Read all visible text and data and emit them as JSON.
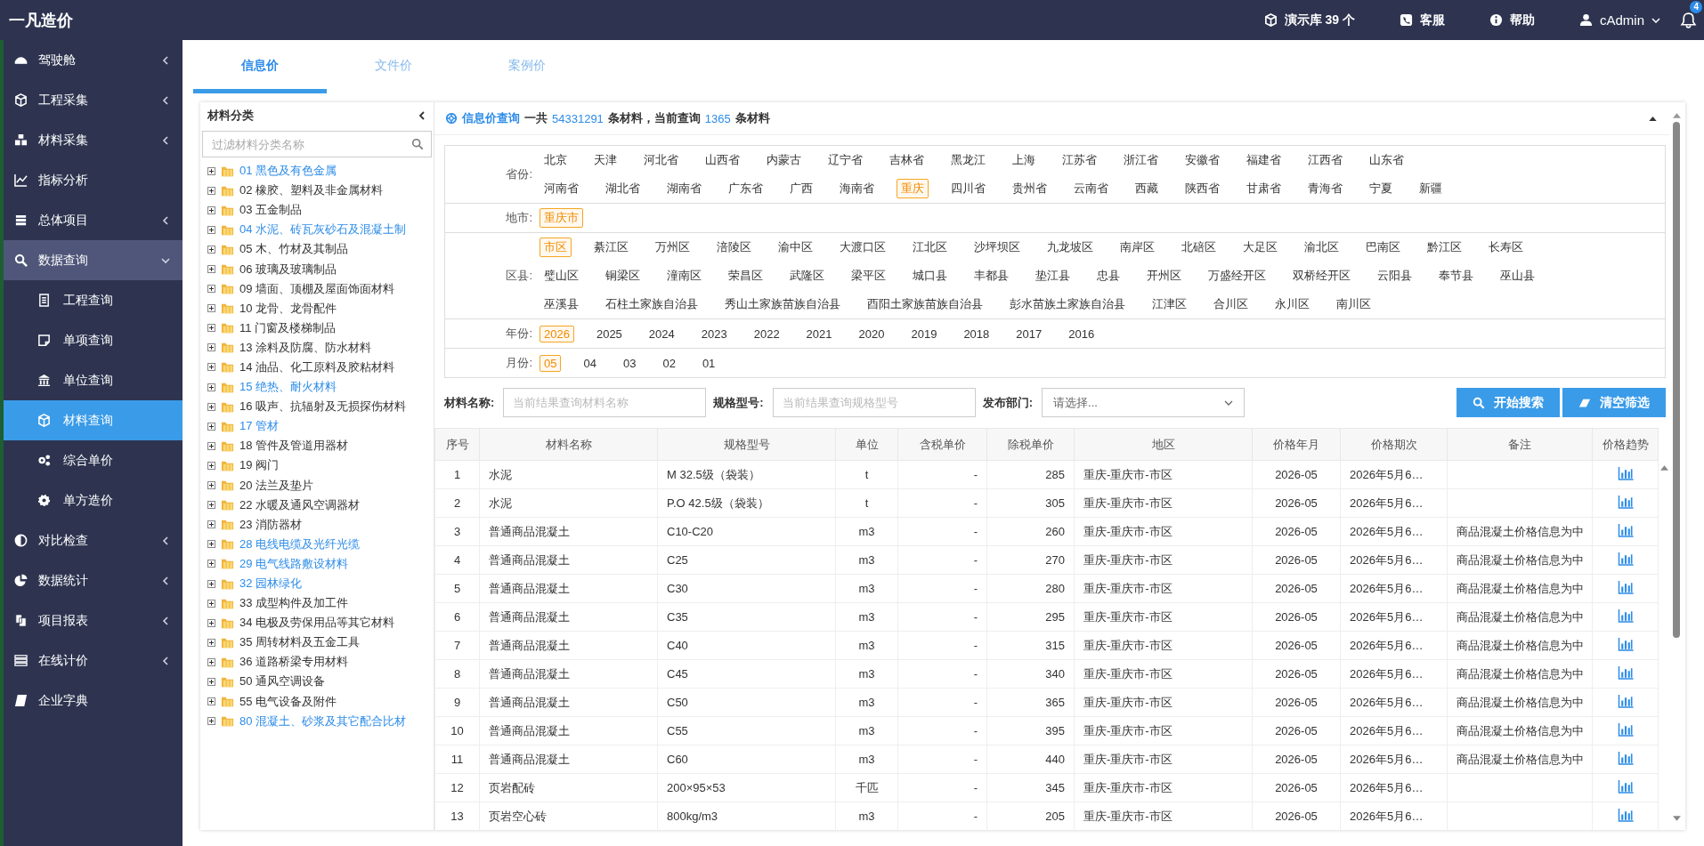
{
  "header": {
    "logo": "一凡造价",
    "library": "演示库 39 个",
    "service": "客服",
    "help": "帮助",
    "user": "cAdmin",
    "notifications": "4"
  },
  "sidebar": {
    "items": [
      {
        "label": "驾驶舱",
        "kind": "group",
        "expanded": false,
        "selected": false
      },
      {
        "label": "工程采集",
        "kind": "group",
        "expanded": false,
        "selected": false
      },
      {
        "label": "材料采集",
        "kind": "group",
        "expanded": false,
        "selected": false
      },
      {
        "label": "指标分析",
        "kind": "link",
        "selected": false
      },
      {
        "label": "总体项目",
        "kind": "group",
        "expanded": false,
        "selected": false
      },
      {
        "label": "数据查询",
        "kind": "group",
        "expanded": true,
        "selected": false,
        "children": [
          {
            "label": "工程查询",
            "selected": false
          },
          {
            "label": "单项查询",
            "selected": false
          },
          {
            "label": "单位查询",
            "selected": false
          },
          {
            "label": "材料查询",
            "selected": true
          },
          {
            "label": "综合单价",
            "selected": false
          },
          {
            "label": "单方造价",
            "selected": false
          }
        ]
      },
      {
        "label": "对比检查",
        "kind": "group",
        "expanded": false,
        "selected": false
      },
      {
        "label": "数据统计",
        "kind": "group",
        "expanded": false,
        "selected": false
      },
      {
        "label": "项目报表",
        "kind": "group",
        "expanded": false,
        "selected": false
      },
      {
        "label": "在线计价",
        "kind": "group",
        "expanded": false,
        "selected": false
      },
      {
        "label": "企业字典",
        "kind": "link",
        "selected": false
      }
    ]
  },
  "tabs": [
    {
      "label": "信息价",
      "selected": true
    },
    {
      "label": "文件价",
      "selected": false
    },
    {
      "label": "案例价",
      "selected": false
    }
  ],
  "category_tree": {
    "title": "材料分类",
    "search": {
      "placeholder": "过滤材料分类名称"
    },
    "items": [
      {
        "label": "01 黑色及有色金属",
        "highlighted": true,
        "expanded": false
      },
      {
        "label": "02 橡胶、塑料及非金属材料",
        "highlighted": false,
        "expanded": false
      },
      {
        "label": "03 五金制品",
        "highlighted": false,
        "expanded": false
      },
      {
        "label": "04 水泥、砖瓦灰砂石及混凝土制",
        "highlighted": true,
        "expanded": false
      },
      {
        "label": "05 木、竹材及其制品",
        "highlighted": false,
        "expanded": false
      },
      {
        "label": "06 玻璃及玻璃制品",
        "highlighted": false,
        "expanded": false
      },
      {
        "label": "09 墙面、顶棚及屋面饰面材料",
        "highlighted": false,
        "expanded": false
      },
      {
        "label": "10 龙骨、龙骨配件",
        "highlighted": false,
        "expanded": false
      },
      {
        "label": "11 门窗及楼梯制品",
        "highlighted": false,
        "expanded": false
      },
      {
        "label": "13 涂料及防腐、防水材料",
        "highlighted": false,
        "expanded": false
      },
      {
        "label": "14 油品、化工原料及胶粘材料",
        "highlighted": false,
        "expanded": false
      },
      {
        "label": "15 绝热、耐火材料",
        "highlighted": true,
        "expanded": false
      },
      {
        "label": "16 吸声、抗辐射及无损探伤材料",
        "highlighted": false,
        "expanded": false
      },
      {
        "label": "17 管材",
        "highlighted": true,
        "expanded": false
      },
      {
        "label": "18 管件及管道用器材",
        "highlighted": false,
        "expanded": false
      },
      {
        "label": "19 阀门",
        "highlighted": false,
        "expanded": false
      },
      {
        "label": "20 法兰及垫片",
        "highlighted": false,
        "expanded": false
      },
      {
        "label": "22 水暖及通风空调器材",
        "highlighted": false,
        "expanded": false
      },
      {
        "label": "23 消防器材",
        "highlighted": false,
        "expanded": false
      },
      {
        "label": "28 电线电缆及光纤光缆",
        "highlighted": true,
        "expanded": false
      },
      {
        "label": "29 电气线路敷设材料",
        "highlighted": true,
        "expanded": false
      },
      {
        "label": "32 园林绿化",
        "highlighted": true,
        "expanded": false
      },
      {
        "label": "33 成型构件及加工件",
        "highlighted": false,
        "expanded": false
      },
      {
        "label": "34 电极及劳保用品等其它材料",
        "highlighted": false,
        "expanded": false
      },
      {
        "label": "35 周转材料及五金工具",
        "highlighted": false,
        "expanded": false
      },
      {
        "label": "36 道路桥梁专用材料",
        "highlighted": false,
        "expanded": false
      },
      {
        "label": "50 通风空调设备",
        "highlighted": false,
        "expanded": false
      },
      {
        "label": "55 电气设备及附件",
        "highlighted": false,
        "expanded": false
      },
      {
        "label": "80 混凝土、砂浆及其它配合比材",
        "highlighted": true,
        "expanded": false
      }
    ]
  },
  "query_panel": {
    "title": "信息价查询",
    "summary": [
      {
        "text": "一共",
        "accent": false
      },
      {
        "text": "54331291",
        "accent": true
      },
      {
        "text": "条材料，当前查询",
        "accent": false
      },
      {
        "text": "1365",
        "accent": true
      },
      {
        "text": "条材料",
        "accent": false
      }
    ]
  },
  "filters": [
    {
      "label": "省份:",
      "lines": [
        [
          {
            "label": "北京",
            "selected": false
          },
          {
            "label": "天津",
            "selected": false
          },
          {
            "label": "河北省",
            "selected": false
          },
          {
            "label": "山西省",
            "selected": false
          },
          {
            "label": "内蒙古",
            "selected": false
          },
          {
            "label": "辽宁省",
            "selected": false
          },
          {
            "label": "吉林省",
            "selected": false
          },
          {
            "label": "黑龙江",
            "selected": false
          },
          {
            "label": "上海",
            "selected": false
          },
          {
            "label": "江苏省",
            "selected": false
          },
          {
            "label": "浙江省",
            "selected": false
          },
          {
            "label": "安徽省",
            "selected": false
          },
          {
            "label": "福建省",
            "selected": false
          },
          {
            "label": "江西省",
            "selected": false
          },
          {
            "label": "山东省",
            "selected": false
          }
        ],
        [
          {
            "label": "河南省",
            "selected": false
          },
          {
            "label": "湖北省",
            "selected": false
          },
          {
            "label": "湖南省",
            "selected": false
          },
          {
            "label": "广东省",
            "selected": false
          },
          {
            "label": "广西",
            "selected": false
          },
          {
            "label": "海南省",
            "selected": false
          },
          {
            "label": "重庆",
            "selected": true
          },
          {
            "label": "四川省",
            "selected": false
          },
          {
            "label": "贵州省",
            "selected": false
          },
          {
            "label": "云南省",
            "selected": false
          },
          {
            "label": "西藏",
            "selected": false
          },
          {
            "label": "陕西省",
            "selected": false
          },
          {
            "label": "甘肃省",
            "selected": false
          },
          {
            "label": "青海省",
            "selected": false
          },
          {
            "label": "宁夏",
            "selected": false
          },
          {
            "label": "新疆",
            "selected": false
          }
        ]
      ]
    },
    {
      "label": "地市:",
      "lines": [
        [
          {
            "label": "重庆市",
            "selected": true
          }
        ]
      ]
    },
    {
      "label": "区县:",
      "lines": [
        [
          {
            "label": "市区",
            "selected": true
          },
          {
            "label": "綦江区",
            "selected": false
          },
          {
            "label": "万州区",
            "selected": false
          },
          {
            "label": "涪陵区",
            "selected": false
          },
          {
            "label": "渝中区",
            "selected": false
          },
          {
            "label": "大渡口区",
            "selected": false
          },
          {
            "label": "江北区",
            "selected": false
          },
          {
            "label": "沙坪坝区",
            "selected": false
          },
          {
            "label": "九龙坡区",
            "selected": false
          },
          {
            "label": "南岸区",
            "selected": false
          },
          {
            "label": "北碚区",
            "selected": false
          },
          {
            "label": "大足区",
            "selected": false
          },
          {
            "label": "渝北区",
            "selected": false
          },
          {
            "label": "巴南区",
            "selected": false
          },
          {
            "label": "黔江区",
            "selected": false
          },
          {
            "label": "长寿区",
            "selected": false
          }
        ],
        [
          {
            "label": "璧山区",
            "selected": false
          },
          {
            "label": "铜梁区",
            "selected": false
          },
          {
            "label": "潼南区",
            "selected": false
          },
          {
            "label": "荣昌区",
            "selected": false
          },
          {
            "label": "武隆区",
            "selected": false
          },
          {
            "label": "梁平区",
            "selected": false
          },
          {
            "label": "城口县",
            "selected": false
          },
          {
            "label": "丰都县",
            "selected": false
          },
          {
            "label": "垫江县",
            "selected": false
          },
          {
            "label": "忠县",
            "selected": false
          },
          {
            "label": "开州区",
            "selected": false
          },
          {
            "label": "万盛经开区",
            "selected": false
          },
          {
            "label": "双桥经开区",
            "selected": false
          },
          {
            "label": "云阳县",
            "selected": false
          },
          {
            "label": "奉节县",
            "selected": false
          },
          {
            "label": "巫山县",
            "selected": false
          }
        ],
        [
          {
            "label": "巫溪县",
            "selected": false
          },
          {
            "label": "石柱土家族自治县",
            "selected": false
          },
          {
            "label": "秀山土家族苗族自治县",
            "selected": false
          },
          {
            "label": "酉阳土家族苗族自治县",
            "selected": false
          },
          {
            "label": "彭水苗族土家族自治县",
            "selected": false
          },
          {
            "label": "江津区",
            "selected": false
          },
          {
            "label": "合川区",
            "selected": false
          },
          {
            "label": "永川区",
            "selected": false
          },
          {
            "label": "南川区",
            "selected": false
          }
        ]
      ]
    },
    {
      "label": "年份:",
      "lines": [
        [
          {
            "label": "2026",
            "selected": true
          },
          {
            "label": "2025",
            "selected": false
          },
          {
            "label": "2024",
            "selected": false
          },
          {
            "label": "2023",
            "selected": false
          },
          {
            "label": "2022",
            "selected": false
          },
          {
            "label": "2021",
            "selected": false
          },
          {
            "label": "2020",
            "selected": false
          },
          {
            "label": "2019",
            "selected": false
          },
          {
            "label": "2018",
            "selected": false
          },
          {
            "label": "2017",
            "selected": false
          },
          {
            "label": "2016",
            "selected": false
          }
        ]
      ]
    },
    {
      "label": "月份:",
      "lines": [
        [
          {
            "label": "05",
            "selected": true
          },
          {
            "label": "04",
            "selected": false
          },
          {
            "label": "03",
            "selected": false
          },
          {
            "label": "02",
            "selected": false
          },
          {
            "label": "01",
            "selected": false
          }
        ]
      ]
    }
  ],
  "search_form": {
    "fields": [
      {
        "label": "材料名称:",
        "kind": "input",
        "placeholder": "当前结果查询材料名称"
      },
      {
        "label": "规格型号:",
        "kind": "input",
        "placeholder": "当前结果查询规格型号"
      },
      {
        "label": "发布部门:",
        "kind": "select",
        "placeholder": "请选择..."
      }
    ],
    "buttons": [
      {
        "label": "开始搜索",
        "kind": "search"
      },
      {
        "label": "清空筛选",
        "kind": "clear"
      }
    ]
  },
  "table": {
    "columns": [
      "序号",
      "材料名称",
      "规格型号",
      "单位",
      "含税单价",
      "除税单价",
      "地区",
      "价格年月",
      "价格期次",
      "备注",
      "价格趋势"
    ],
    "rows": [
      {
        "no": "1",
        "name": "水泥",
        "spec": "M 32.5级（袋装）",
        "unit": "t",
        "tax_price": "-",
        "net_price": "285",
        "region": "重庆-重庆市-市区",
        "month": "2026-05",
        "period": "2026年5月6…"
      },
      {
        "no": "2",
        "name": "水泥",
        "spec": "P.O 42.5级（袋装）",
        "unit": "t",
        "tax_price": "-",
        "net_price": "305",
        "region": "重庆-重庆市-市区",
        "month": "2026-05",
        "period": "2026年5月6…"
      },
      {
        "no": "3",
        "name": "普通商品混凝土",
        "spec": "C10-C20",
        "unit": "m3",
        "tax_price": "-",
        "net_price": "260",
        "region": "重庆-重庆市-市区",
        "month": "2026-05",
        "period": "2026年5月6…",
        "note": "商品混凝土价格信息为中"
      },
      {
        "no": "4",
        "name": "普通商品混凝土",
        "spec": "C25",
        "unit": "m3",
        "tax_price": "-",
        "net_price": "270",
        "region": "重庆-重庆市-市区",
        "month": "2026-05",
        "period": "2026年5月6…",
        "note": "商品混凝土价格信息为中"
      },
      {
        "no": "5",
        "name": "普通商品混凝土",
        "spec": "C30",
        "unit": "m3",
        "tax_price": "-",
        "net_price": "280",
        "region": "重庆-重庆市-市区",
        "month": "2026-05",
        "period": "2026年5月6…",
        "note": "商品混凝土价格信息为中"
      },
      {
        "no": "6",
        "name": "普通商品混凝土",
        "spec": "C35",
        "unit": "m3",
        "tax_price": "-",
        "net_price": "295",
        "region": "重庆-重庆市-市区",
        "month": "2026-05",
        "period": "2026年5月6…",
        "note": "商品混凝土价格信息为中"
      },
      {
        "no": "7",
        "name": "普通商品混凝土",
        "spec": "C40",
        "unit": "m3",
        "tax_price": "-",
        "net_price": "315",
        "region": "重庆-重庆市-市区",
        "month": "2026-05",
        "period": "2026年5月6…",
        "note": "商品混凝土价格信息为中"
      },
      {
        "no": "8",
        "name": "普通商品混凝土",
        "spec": "C45",
        "unit": "m3",
        "tax_price": "-",
        "net_price": "340",
        "region": "重庆-重庆市-市区",
        "month": "2026-05",
        "period": "2026年5月6…",
        "note": "商品混凝土价格信息为中"
      },
      {
        "no": "9",
        "name": "普通商品混凝土",
        "spec": "C50",
        "unit": "m3",
        "tax_price": "-",
        "net_price": "365",
        "region": "重庆-重庆市-市区",
        "month": "2026-05",
        "period": "2026年5月6…",
        "note": "商品混凝土价格信息为中"
      },
      {
        "no": "10",
        "name": "普通商品混凝土",
        "spec": "C55",
        "unit": "m3",
        "tax_price": "-",
        "net_price": "395",
        "region": "重庆-重庆市-市区",
        "month": "2026-05",
        "period": "2026年5月6…",
        "note": "商品混凝土价格信息为中"
      },
      {
        "no": "11",
        "name": "普通商品混凝土",
        "spec": "C60",
        "unit": "m3",
        "tax_price": "-",
        "net_price": "440",
        "region": "重庆-重庆市-市区",
        "month": "2026-05",
        "period": "2026年5月6…",
        "note": "商品混凝土价格信息为中"
      },
      {
        "no": "12",
        "name": "页岩配砖",
        "spec": "200×95×53",
        "unit": "千匹",
        "tax_price": "-",
        "net_price": "345",
        "region": "重庆-重庆市-市区",
        "month": "2026-05",
        "period": "2026年5月6…"
      },
      {
        "no": "13",
        "name": "页岩空心砖",
        "spec": "800kg/m3",
        "unit": "m3",
        "tax_price": "-",
        "net_price": "205",
        "region": "重庆-重庆市-市区",
        "month": "2026-05",
        "period": "2026年5月6…"
      }
    ]
  }
}
